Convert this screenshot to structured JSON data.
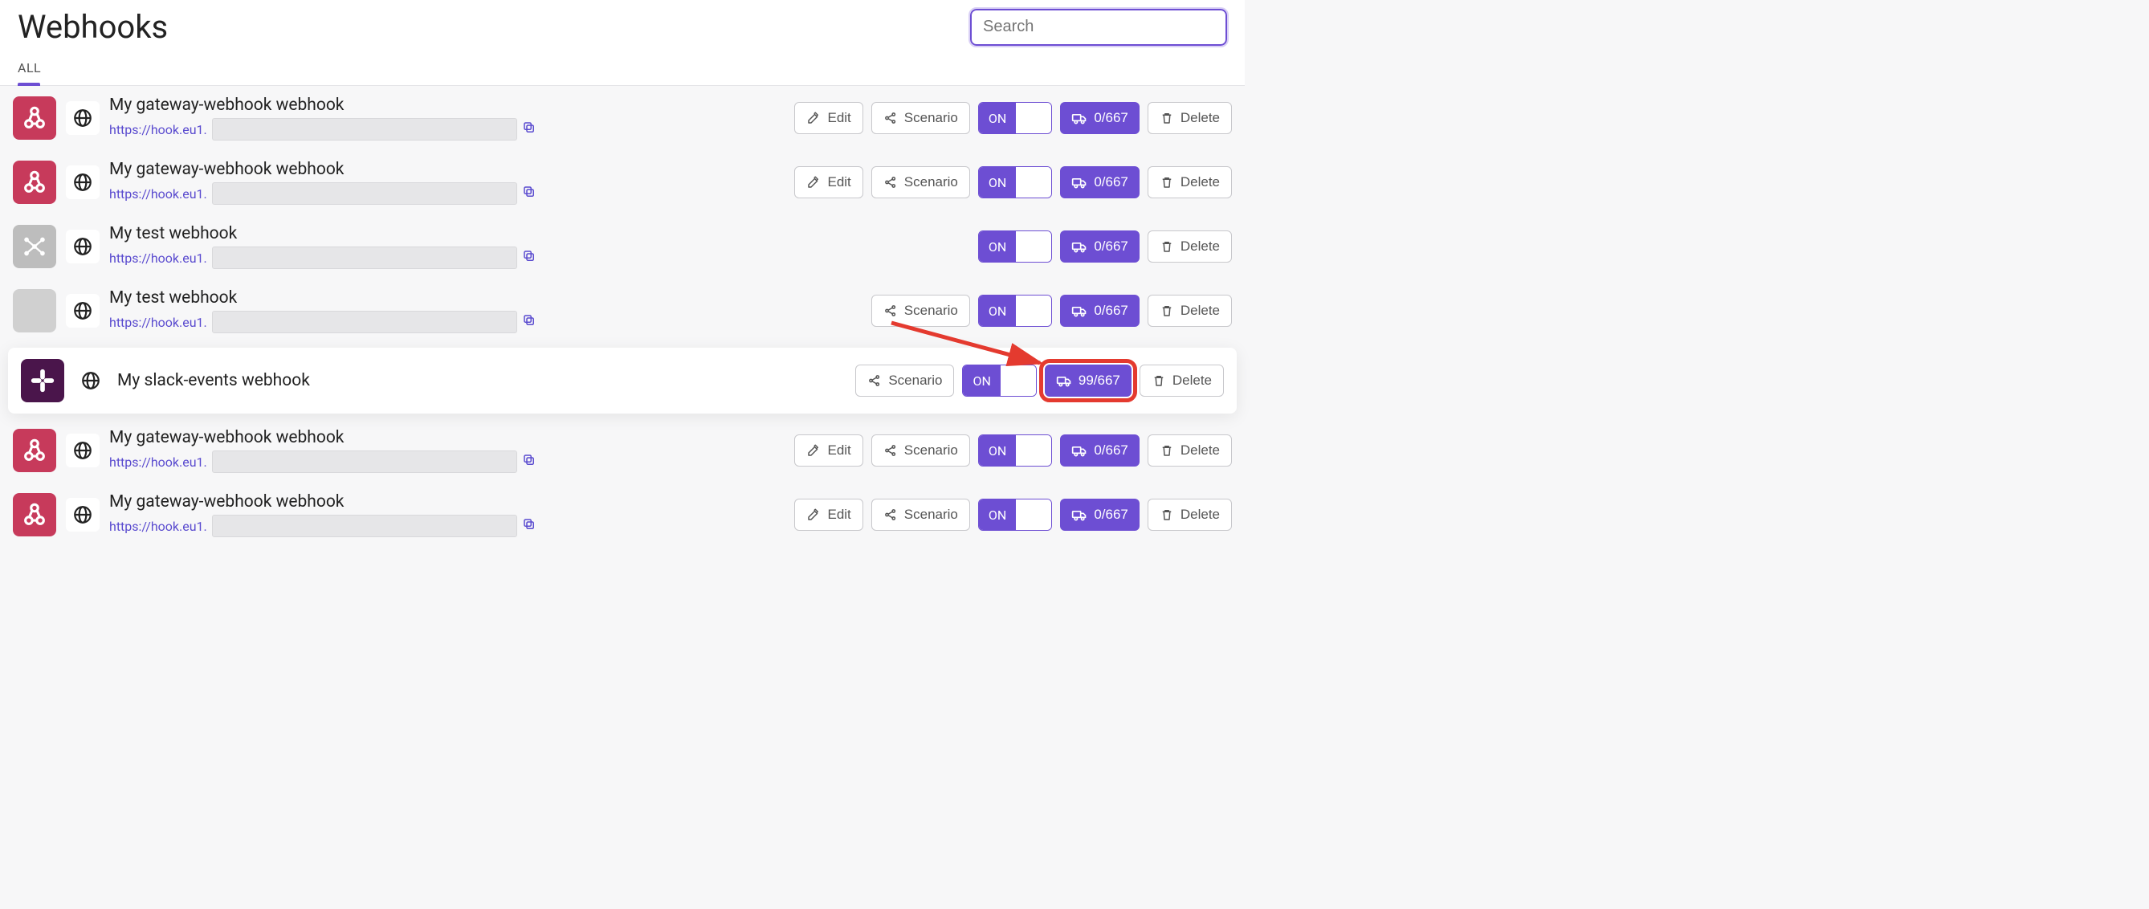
{
  "header": {
    "title": "Webhooks",
    "search_placeholder": "Search"
  },
  "tabs": {
    "all": "ALL"
  },
  "labels": {
    "edit": "Edit",
    "scenario": "Scenario",
    "on": "ON",
    "delete": "Delete"
  },
  "webhooks": [
    {
      "name": "My gateway-webhook webhook",
      "url_prefix": "https://hook.eu1.",
      "icon": "crimson",
      "icon_glyph": "webhook",
      "has_edit": true,
      "has_scenario": true,
      "queue": "0/667",
      "show_url": true,
      "highlight": false
    },
    {
      "name": "My gateway-webhook webhook",
      "url_prefix": "https://hook.eu1.",
      "icon": "crimson",
      "icon_glyph": "webhook",
      "has_edit": true,
      "has_scenario": true,
      "queue": "0/667",
      "show_url": true,
      "highlight": false
    },
    {
      "name": "My test webhook",
      "url_prefix": "https://hook.eu1.",
      "icon": "grey",
      "icon_glyph": "network",
      "has_edit": false,
      "has_scenario": false,
      "queue": "0/667",
      "show_url": true,
      "highlight": false
    },
    {
      "name": "My test webhook",
      "url_prefix": "https://hook.eu1.",
      "icon": "lightgrey",
      "icon_glyph": "none",
      "has_edit": false,
      "has_scenario": true,
      "queue": "0/667",
      "show_url": true,
      "highlight": false
    },
    {
      "name": "My slack-events webhook",
      "url_prefix": "",
      "icon": "slack",
      "icon_glyph": "slack",
      "has_edit": false,
      "has_scenario": true,
      "queue": "99/667",
      "show_url": false,
      "highlight": true
    },
    {
      "name": "My gateway-webhook webhook",
      "url_prefix": "https://hook.eu1.",
      "icon": "crimson",
      "icon_glyph": "webhook",
      "has_edit": true,
      "has_scenario": true,
      "queue": "0/667",
      "show_url": true,
      "highlight": false
    },
    {
      "name": "My gateway-webhook webhook",
      "url_prefix": "https://hook.eu1.",
      "icon": "crimson",
      "icon_glyph": "webhook",
      "has_edit": true,
      "has_scenario": true,
      "queue": "0/667",
      "show_url": true,
      "highlight": false
    }
  ]
}
